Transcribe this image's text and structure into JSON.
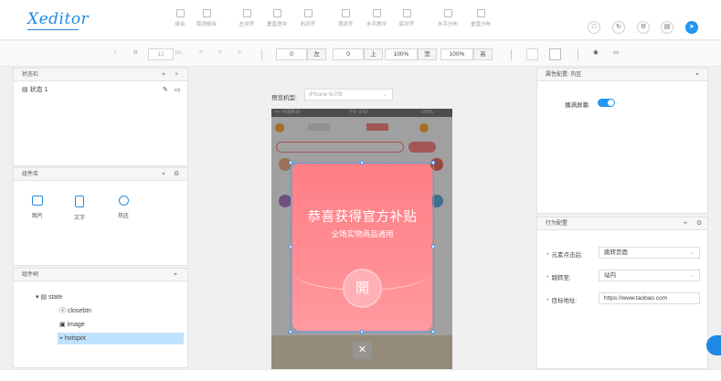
{
  "header": {
    "logo": "Xeditor",
    "toolbar": [
      {
        "label": "组合",
        "icon": "group-icon"
      },
      {
        "label": "取消组合",
        "icon": "ungroup-icon"
      },
      {
        "label": "左对齐",
        "icon": "align-left-icon"
      },
      {
        "label": "垂直居中",
        "icon": "align-center-v-icon"
      },
      {
        "label": "右对齐",
        "icon": "align-right-icon"
      },
      {
        "label": "顶对齐",
        "icon": "align-top-icon"
      },
      {
        "label": "水平居中",
        "icon": "align-center-h-icon"
      },
      {
        "label": "底对齐",
        "icon": "align-bottom-icon"
      },
      {
        "label": "水平分布",
        "icon": "distribute-h-icon"
      },
      {
        "label": "垂直分布",
        "icon": "distribute-v-icon"
      }
    ],
    "right_buttons": [
      "file-icon",
      "refresh-icon",
      "settings-icon",
      "save-icon",
      "publish-icon"
    ],
    "accent": "#2196f3"
  },
  "format_bar": {
    "italic": "I",
    "bold": "B",
    "font_size": "12",
    "font_unit": "px",
    "x": "0",
    "x_label": "左",
    "y": "0",
    "y_label": "上",
    "width": "100%",
    "width_label": "宽",
    "height": "100%",
    "height_label": "高"
  },
  "state_panel": {
    "title": "状态栏",
    "items": [
      {
        "label": "状态 1"
      }
    ]
  },
  "library_panel": {
    "title": "组件库",
    "items": [
      {
        "label": "图片",
        "icon": "image-icon"
      },
      {
        "label": "文字",
        "icon": "text-icon"
      },
      {
        "label": "热区",
        "icon": "hotspot-icon"
      }
    ]
  },
  "tree_panel": {
    "title": "组件树",
    "root": "state",
    "children": [
      "closebtn",
      "image",
      "hotspot"
    ]
  },
  "canvas": {
    "preview_label": "预览机型:",
    "device": "iPhone 6/7/8",
    "phone": {
      "status": "•••• 中国移动",
      "time": "下午 9:42",
      "battery": "100%"
    },
    "popup": {
      "title": "恭喜获得官方补贴",
      "subtitle": "全场实物商品通用",
      "open_label": "開",
      "close_label": "✕"
    }
  },
  "props_panel": {
    "title": "属性配置: 热区",
    "fullscreen_label": "播满屏幕:",
    "fullscreen_on": true
  },
  "behavior_panel": {
    "title": "行为配置",
    "fields": [
      {
        "label": "元素点击后:",
        "value": "跳转页面",
        "type": "select"
      },
      {
        "label": "跳转至:",
        "value": "站内",
        "type": "select"
      },
      {
        "label": "目标地址:",
        "value": "https://www.taobao.com",
        "type": "input"
      }
    ]
  }
}
